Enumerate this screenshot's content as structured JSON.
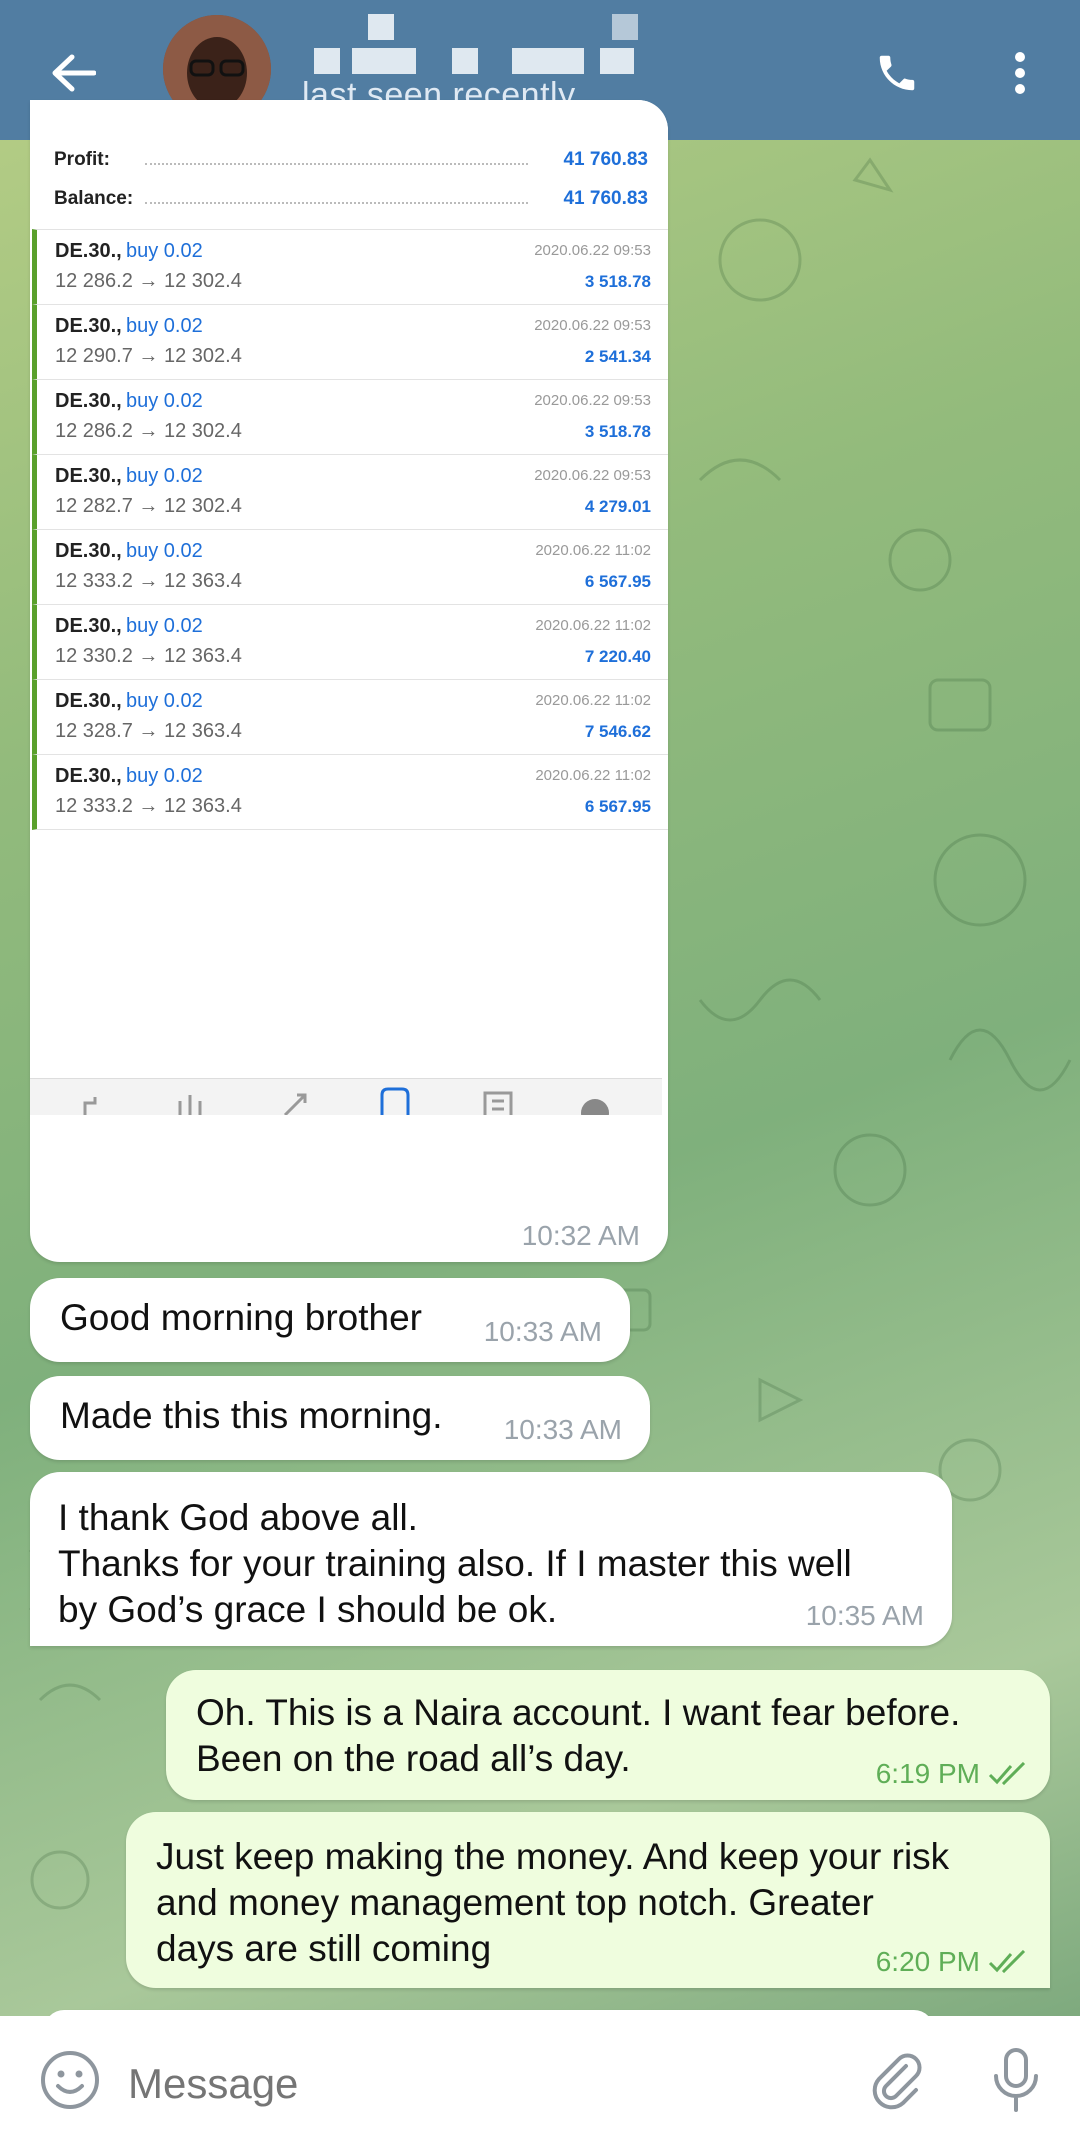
{
  "header": {
    "back_icon": "arrow-left-icon",
    "status": "last seen recently",
    "call_icon": "phone-icon",
    "more_icon": "more-vertical-icon",
    "bg_color": "#517da2"
  },
  "screenshot": {
    "profit_label": "Profit:",
    "profit_value": "41 760.83",
    "balance_label": "Balance:",
    "balance_value": "41 760.83",
    "trades": [
      {
        "symbol": "DE.30.,",
        "side": "buy 0.02",
        "prices": "12 286.2 → 12 302.4",
        "date": "2020.06.22 09:53",
        "profit": "3 518.78"
      },
      {
        "symbol": "DE.30.,",
        "side": "buy 0.02",
        "prices": "12 290.7 → 12 302.4",
        "date": "2020.06.22 09:53",
        "profit": "2 541.34"
      },
      {
        "symbol": "DE.30.,",
        "side": "buy 0.02",
        "prices": "12 286.2 → 12 302.4",
        "date": "2020.06.22 09:53",
        "profit": "3 518.78"
      },
      {
        "symbol": "DE.30.,",
        "side": "buy 0.02",
        "prices": "12 282.7 → 12 302.4",
        "date": "2020.06.22 09:53",
        "profit": "4 279.01"
      },
      {
        "symbol": "DE.30.,",
        "side": "buy 0.02",
        "prices": "12 333.2 → 12 363.4",
        "date": "2020.06.22 11:02",
        "profit": "6 567.95"
      },
      {
        "symbol": "DE.30.,",
        "side": "buy 0.02",
        "prices": "12 330.2 → 12 363.4",
        "date": "2020.06.22 11:02",
        "profit": "7 220.40"
      },
      {
        "symbol": "DE.30.,",
        "side": "buy 0.02",
        "prices": "12 328.7 → 12 363.4",
        "date": "2020.06.22 11:02",
        "profit": "7 546.62"
      },
      {
        "symbol": "DE.30.,",
        "side": "buy 0.02",
        "prices": "12 333.2 → 12 363.4",
        "date": "2020.06.22 11:02",
        "profit": "6 567.95"
      }
    ],
    "time": "10:32 AM"
  },
  "messages": [
    {
      "direction": "in",
      "text": "Good morning brother",
      "time": "10:33 AM"
    },
    {
      "direction": "in",
      "text": "Made this this morning.",
      "time": "10:33 AM"
    },
    {
      "direction": "in",
      "text": "I thank God above all.\nThanks for your training also. If I master this well\nby God’s grace I should be ok.",
      "time": "10:35 AM"
    },
    {
      "direction": "out",
      "text": "Oh. This is a Naira account. I want fear before.\nBeen on the road all’s day.",
      "time": "6:19 PM",
      "status_icon": "double-check-icon"
    },
    {
      "direction": "out",
      "text": "Just keep making the money. And keep your risk\nand money management top notch. Greater\ndays are still coming",
      "time": "6:20 PM",
      "status_icon": "double-check-icon"
    }
  ],
  "input": {
    "placeholder": "Message",
    "emoji_icon": "smile-icon",
    "attach_icon": "paperclip-icon",
    "mic_icon": "microphone-icon"
  },
  "colors": {
    "incoming_bubble": "#ffffff",
    "outgoing_bubble": "#effdde",
    "outgoing_time": "#5fae57",
    "link_blue": "#1e6fd9"
  }
}
